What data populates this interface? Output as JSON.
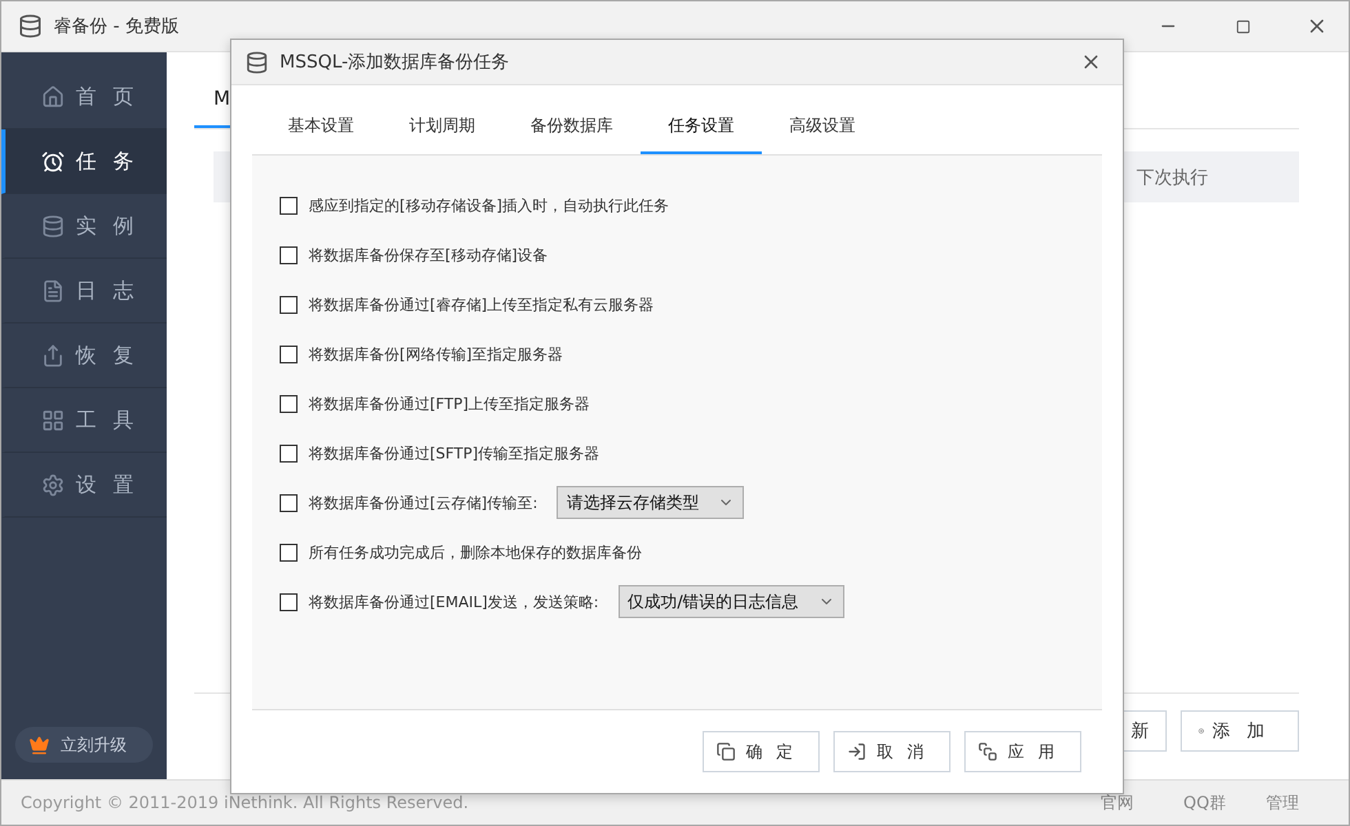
{
  "window": {
    "title": "睿备份 - 免费版"
  },
  "sidebar": {
    "items": [
      {
        "label": "首页",
        "selected": false
      },
      {
        "label": "任务",
        "selected": true
      },
      {
        "label": "实例",
        "selected": false
      },
      {
        "label": "日志",
        "selected": false
      },
      {
        "label": "恢复",
        "selected": false
      },
      {
        "label": "工具",
        "selected": false
      },
      {
        "label": "设置",
        "selected": false
      }
    ],
    "upgrade_button": "立刻升级"
  },
  "main": {
    "tabs": [
      {
        "label": "M",
        "selected": true
      }
    ],
    "table": {
      "columns": [
        {
          "label": "下次执行"
        }
      ]
    },
    "buttons": [
      {
        "kind": "partial",
        "label": "新"
      },
      {
        "kind": "add",
        "label": "添加"
      }
    ]
  },
  "dialog": {
    "title": "MSSQL-添加数据库备份任务",
    "tabs": [
      {
        "label": "基本设置",
        "selected": false
      },
      {
        "label": "计划周期",
        "selected": false
      },
      {
        "label": "备份数据库",
        "selected": false
      },
      {
        "label": "任务设置",
        "selected": true
      },
      {
        "label": "高级设置",
        "selected": false
      }
    ],
    "options": [
      {
        "kind": "plain",
        "label": "感应到指定的[移动存储设备]插入时，自动执行此任务",
        "checked": false
      },
      {
        "kind": "plain",
        "label": "将数据库备份保存至[移动存储]设备",
        "checked": false
      },
      {
        "kind": "plain",
        "label": "将数据库备份通过[睿存储]上传至指定私有云服务器",
        "checked": false
      },
      {
        "kind": "plain",
        "label": "将数据库备份[网络传输]至指定服务器",
        "checked": false
      },
      {
        "kind": "plain",
        "label": "将数据库备份通过[FTP]上传至指定服务器",
        "checked": false
      },
      {
        "kind": "plain",
        "label": "将数据库备份通过[SFTP]传输至指定服务器",
        "checked": false
      },
      {
        "kind": "select",
        "label": "将数据库备份通过[云存储]传输至:",
        "checked": false,
        "value": "请选择云存储类型"
      },
      {
        "kind": "plain",
        "label": "所有任务成功完成后，删除本地保存的数据库备份",
        "checked": false
      },
      {
        "kind": "select",
        "label": "将数据库备份通过[EMAIL]发送，发送策略:",
        "checked": false,
        "value": "仅成功/错误的日志信息"
      }
    ],
    "buttons": [
      {
        "label": "确定"
      },
      {
        "label": "取消"
      },
      {
        "label": "应用"
      }
    ]
  },
  "status_bar": {
    "copyright": "Copyright © 2011-2019 iNethink. All Rights Reserved.",
    "links": [
      "官网",
      "QQ群",
      "管理"
    ]
  }
}
